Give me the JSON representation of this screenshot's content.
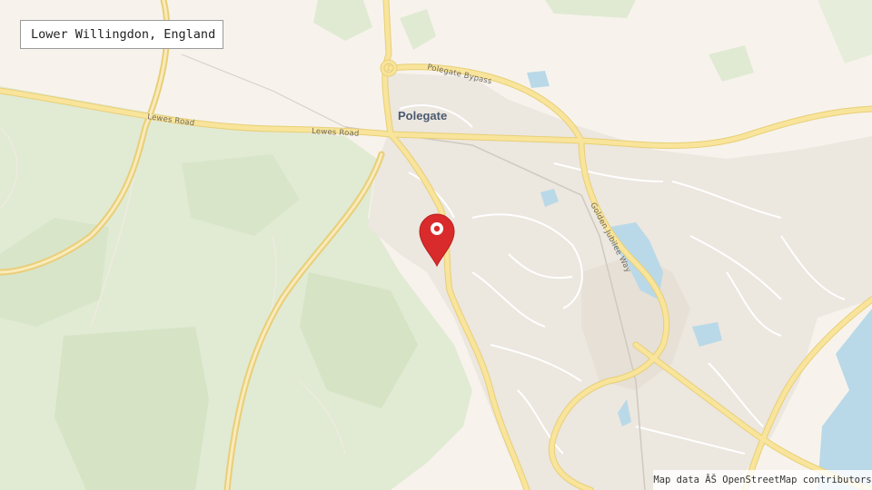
{
  "location_label": "Lower Willingdon, England",
  "attribution": "Map data ÂŠ OpenStreetMap contributors",
  "places": {
    "polegate": "Polegate"
  },
  "roads": {
    "lewes_road_1": "Lewes Road",
    "lewes_road_2": "Lewes Road",
    "polegate_bypass": "Polegate Bypass",
    "golden_jubilee_way": "Golden Jubilee Way"
  },
  "marker": {
    "icon": "map-pin-icon",
    "color": "#d92b2b"
  },
  "colors": {
    "background": "#f7f3ec",
    "woodland": "#dfe9d2",
    "urban": "#ece7df",
    "major_road": "#f7e08c",
    "minor_road": "#ffffff",
    "water": "#b9d9e8"
  }
}
